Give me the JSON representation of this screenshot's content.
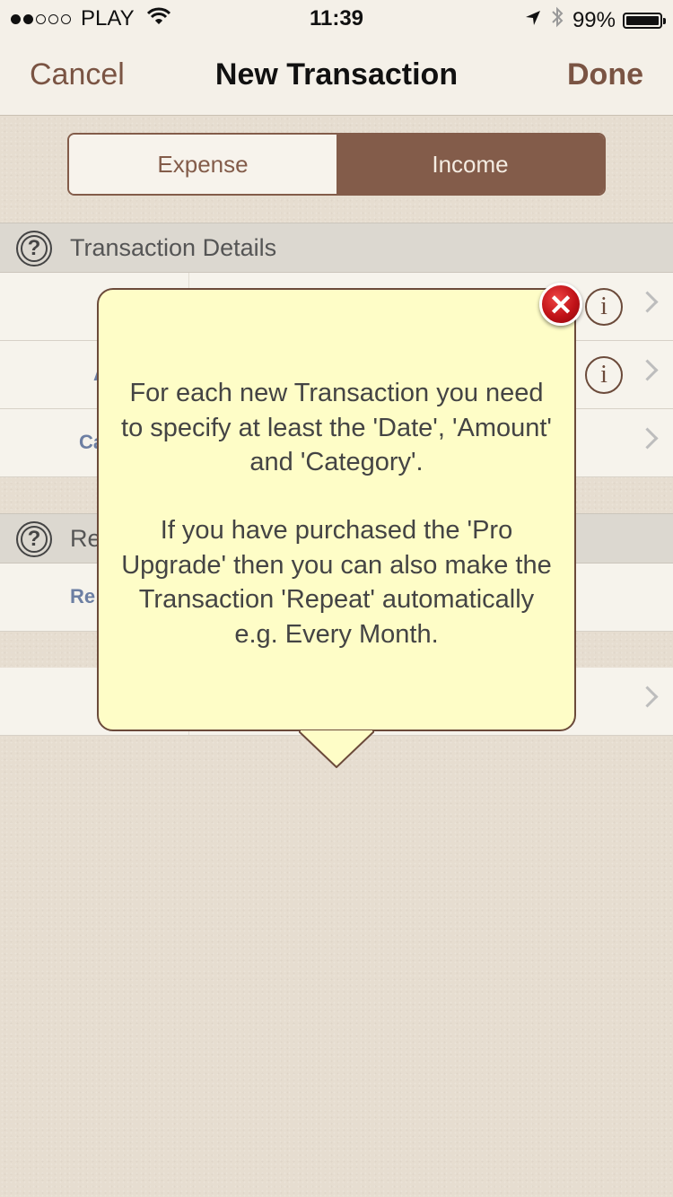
{
  "status_bar": {
    "carrier": "PLAY",
    "signal_bars_filled": 2,
    "signal_bars_total": 5,
    "time": "11:39",
    "battery": "99%",
    "battery_level": 0.99
  },
  "navbar": {
    "cancel_label": "Cancel",
    "title": "New Transaction",
    "done_label": "Done"
  },
  "segmented_control": {
    "options": [
      "Expense",
      "Income"
    ],
    "selected": "Income"
  },
  "sections": {
    "transaction_details": {
      "title": "Transaction Details",
      "partial_labels": [
        "A",
        "Ca"
      ]
    },
    "repeat": {
      "title_partial": "Re",
      "row_partial_label": "Re"
    }
  },
  "popup": {
    "paragraph1": "For each new Transaction you need to specify at least the 'Date', 'Amount' and 'Category'.",
    "paragraph2": "If you have purchased the 'Pro Upgrade' then you can also make the Transaction 'Repeat' automatically e.g. Every Month.",
    "close_symbol": "✕"
  },
  "colors": {
    "accent": "#835c4a",
    "popup_background": "#fefdc7",
    "label_blue": "#6d7fa3",
    "close_red": "#c01218"
  }
}
